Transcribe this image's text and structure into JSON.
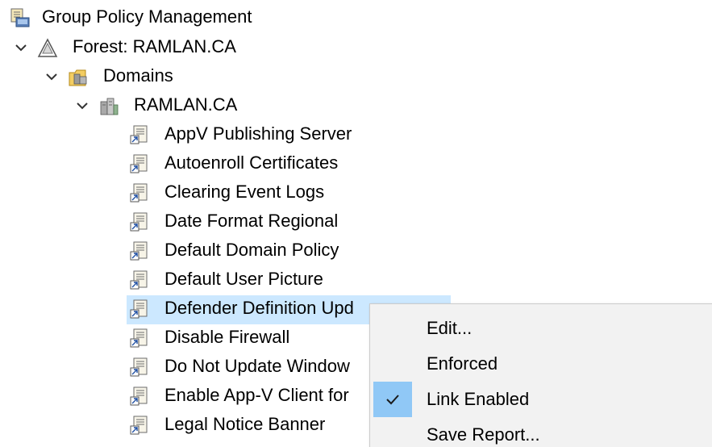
{
  "tree": {
    "root": {
      "label": "Group Policy Management",
      "icon": "gpm-console-icon"
    },
    "forest": {
      "label": "Forest: RAMLAN.CA",
      "icon": "forest-icon"
    },
    "domains": {
      "label": "Domains",
      "icon": "domains-folder-icon"
    },
    "domain": {
      "label": "RAMLAN.CA",
      "icon": "domain-icon"
    },
    "gpo_links": [
      {
        "label": "AppV Publishing Server"
      },
      {
        "label": "Autoenroll Certificates"
      },
      {
        "label": "Clearing Event Logs"
      },
      {
        "label": "Date Format Regional"
      },
      {
        "label": "Default Domain Policy"
      },
      {
        "label": "Default User Picture"
      },
      {
        "label": "Defender Definition Upd",
        "selected": true
      },
      {
        "label": "Disable Firewall"
      },
      {
        "label": "Do Not Update Window"
      },
      {
        "label": "Enable App-V Client for"
      },
      {
        "label": "Legal Notice Banner"
      }
    ]
  },
  "context_menu": {
    "items": [
      {
        "label": "Edit...",
        "checked": false
      },
      {
        "label": "Enforced",
        "checked": false
      },
      {
        "label": "Link Enabled",
        "checked": true
      },
      {
        "label": "Save Report...",
        "checked": false
      }
    ]
  },
  "colors": {
    "selection": "#cce8ff",
    "menu_background": "#f2f2f2",
    "check_highlight": "#90c8f6"
  }
}
